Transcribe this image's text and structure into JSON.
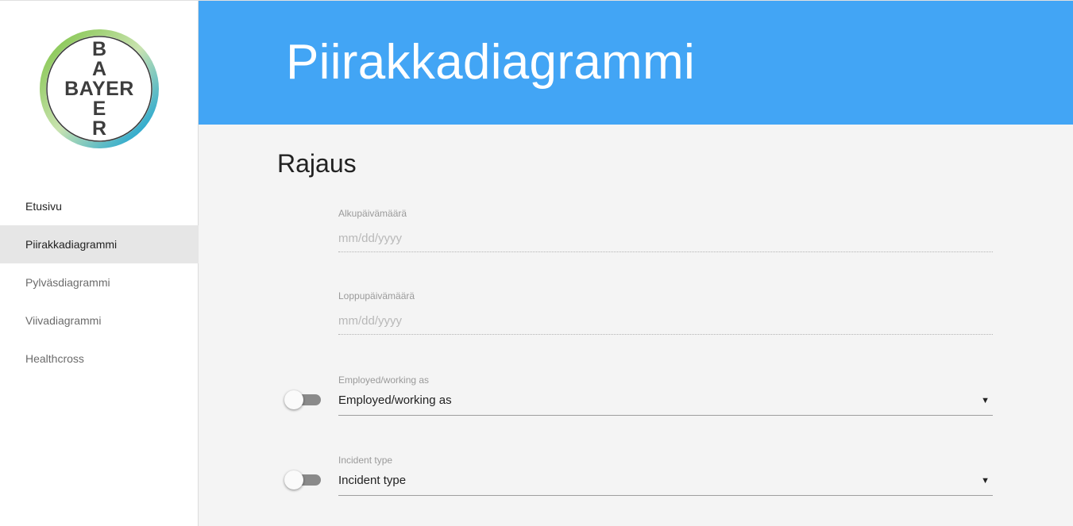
{
  "brand": {
    "logo_text_horizontal": "BAYER",
    "logo_text_vertical": "BAYER"
  },
  "sidebar": {
    "items": [
      {
        "label": "Etusivu"
      },
      {
        "label": "Piirakkadiagrammi",
        "active": true
      },
      {
        "label": "Pylväsdiagrammi"
      },
      {
        "label": "Viivadiagrammi"
      },
      {
        "label": "Healthcross"
      }
    ]
  },
  "header": {
    "title": "Piirakkadiagrammi"
  },
  "section": {
    "title": "Rajaus"
  },
  "filters": {
    "start_date": {
      "label": "Alkupäivämäärä",
      "placeholder": "mm/dd/yyyy"
    },
    "end_date": {
      "label": "Loppupäivämäärä",
      "placeholder": "mm/dd/yyyy"
    },
    "employed": {
      "label": "Employed/working as",
      "value": "Employed/working as",
      "toggle_on": false
    },
    "incident": {
      "label": "Incident type",
      "value": "Incident type",
      "toggle_on": false
    }
  },
  "icons": {
    "dropdown": "caret-down-icon",
    "arrow_glyph": "▼"
  },
  "colors": {
    "header": "#42a5f5",
    "logo_green": "#7cc242",
    "logo_blue": "#0099d8"
  }
}
